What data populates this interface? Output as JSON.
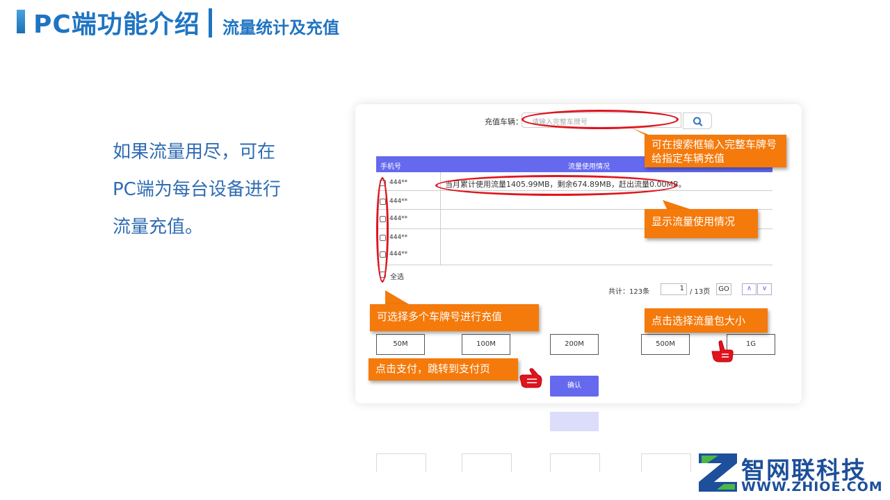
{
  "header": {
    "title": "PC端功能介绍",
    "subtitle": "流量统计及充值"
  },
  "intro": {
    "lines": [
      "如果流量用尽，可在",
      "PC端为每台设备进行",
      "流量充值。"
    ]
  },
  "panel": {
    "search": {
      "label": "充值车辆：",
      "placeholder": "请输入完整车牌号",
      "icon": "search-icon"
    },
    "table": {
      "headers": [
        "手机号",
        "流量使用情况"
      ],
      "rows": [
        {
          "phone": "444**"
        },
        {
          "phone": "444**"
        },
        {
          "phone": "444**"
        },
        {
          "phone": "444**"
        },
        {
          "phone": "444**"
        }
      ],
      "usage_text": "当月累计使用流量1405.99MB，剩余674.89MB，赶出流量0.00MB。",
      "select_all": "全选"
    },
    "pager": {
      "total": "共计：123条",
      "current_page": "1",
      "page_count": "/ 13页",
      "go": "GO",
      "prev": "∧",
      "next": "∨"
    },
    "packages": [
      "50M",
      "100M",
      "200M",
      "500M",
      "1G"
    ],
    "confirm": "确认"
  },
  "callouts": {
    "search": "可在搜索框输入完整车牌号给指定车辆充值",
    "usage": "显示流量使用情况",
    "multi_select": "可选择多个车牌号进行充值",
    "package": "点击选择流量包大小",
    "pay": "点击支付，跳转到支付页"
  },
  "logo": {
    "name": "智网联科技",
    "url": "WWW.ZHIOE.COM"
  },
  "colors": {
    "brand_blue": "#1f74c2",
    "table_header": "#6469ee",
    "callout_orange": "#f47a0c",
    "highlight_red": "#e0141e"
  }
}
